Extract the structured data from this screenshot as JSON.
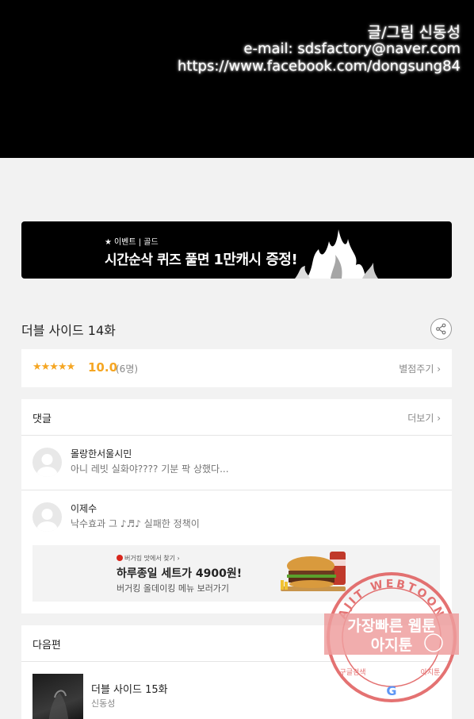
{
  "credits": {
    "line1": "글/그림 신동성",
    "line2": "e-mail: sdsfactory@naver.com",
    "line3": "https://www.facebook.com/dongsung84"
  },
  "event_banner": {
    "tag": "이벤트 | 골드",
    "headline_prefix": "시간순삭 퀴즈 풀면 ",
    "headline_bold": "1만캐시 증정!"
  },
  "episode": {
    "title": "더블 사이드 14화"
  },
  "rating": {
    "stars": "★★★★★",
    "score": "10.0",
    "count": "(6명)",
    "rate_link": "별점주기 ›"
  },
  "comments": {
    "label": "댓글",
    "more": "더보기 ›",
    "items": [
      {
        "name": "몰랑한서울시민",
        "text": "아니 레빗 실화야???? 기분 팍 상했다..."
      },
      {
        "name": "이제수",
        "text": "낙수효과 그 ♪♬♪ 실패한 정책이"
      }
    ]
  },
  "ad": {
    "small": "버거킹 맛에서 찾기 ›",
    "headline": "하루종일 세트가 4900원!",
    "sub": "버거킹 올데이킹 메뉴 보러가기"
  },
  "next": {
    "label": "다음편",
    "episode": "더블 사이드 15화",
    "author": "신동성"
  },
  "watermark": {
    "ring_text": "AJIT WEBTOON",
    "line1": "가장빠른 웹툰",
    "line2": "아지툰",
    "bottom_left": "구글검색",
    "bottom_right": "아지툰"
  },
  "colors": {
    "accent_star": "#f5a623",
    "page_bg": "#f2f2f2",
    "watermark": "#e05a5a"
  }
}
